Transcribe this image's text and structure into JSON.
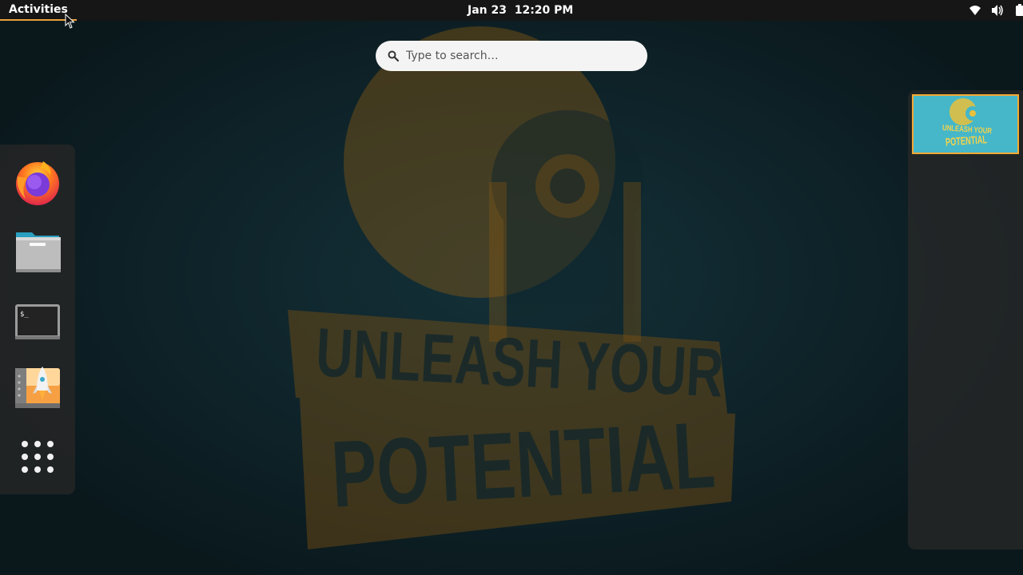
{
  "topbar": {
    "activities_label": "Activities",
    "clock": "Jan 23  12:20 PM",
    "tray_icons": [
      "wifi-icon",
      "volume-icon",
      "battery-icon",
      "system-menu-arrow-icon"
    ]
  },
  "search": {
    "placeholder": "Type to search…"
  },
  "dash": {
    "items": [
      {
        "name": "Firefox",
        "icon": "firefox-icon"
      },
      {
        "name": "Files",
        "icon": "files-icon"
      },
      {
        "name": "Terminal",
        "icon": "terminal-icon"
      },
      {
        "name": "Software",
        "icon": "app-installer-icon"
      },
      {
        "name": "Show Applications",
        "icon": "app-grid-icon"
      }
    ],
    "terminal_prompt": "$_"
  },
  "wallpaper": {
    "line1": "UNLEASH YOUR",
    "line2": "POTENTIAL",
    "colors": {
      "art": "#7a5012",
      "background": "#0f252b"
    }
  },
  "workspaces": {
    "thumb_line1": "UNLEASH YOUR",
    "thumb_line2": "POTENTIAL",
    "colors": {
      "thumb_bg": "#45b7c9",
      "thumb_border": "#f4a833",
      "thumb_art": "#e9c13b"
    }
  },
  "colors": {
    "topbar": "#161616",
    "accent": "#f0a53a"
  }
}
